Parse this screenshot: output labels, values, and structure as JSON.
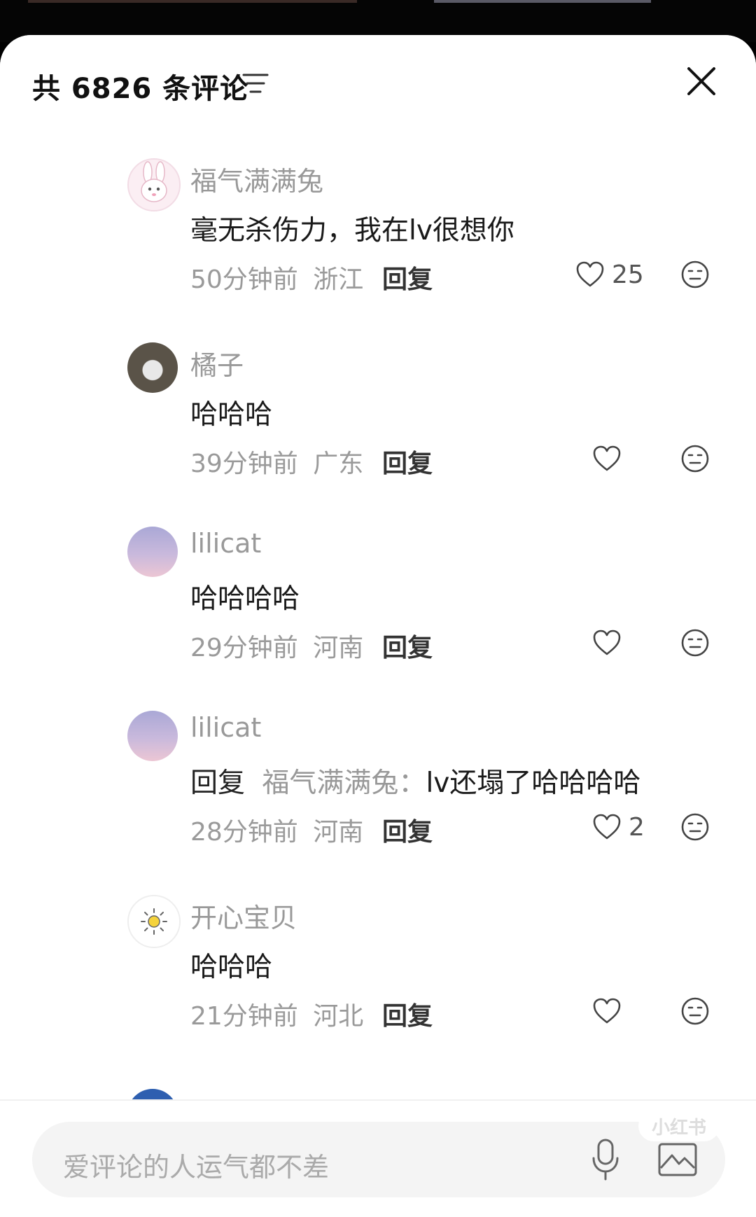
{
  "header": {
    "title": "共 6826 条评论"
  },
  "comments": [
    {
      "name": "福气满满兔",
      "text": "毫无杀伤力，我在lv很想你",
      "time": "50分钟前",
      "region": "浙江",
      "reply_label": "回复",
      "likes": "25",
      "avatar": "bunny-avatar"
    },
    {
      "name": "橘子",
      "text": "哈哈哈",
      "time": "39分钟前",
      "region": "广东",
      "reply_label": "回复",
      "likes": "",
      "avatar": "photo-avatar"
    },
    {
      "name": "lilicat",
      "text": "哈哈哈哈",
      "time": "29分钟前",
      "region": "河南",
      "reply_label": "回复",
      "likes": "",
      "avatar": "gradient-avatar"
    },
    {
      "name": "lilicat",
      "reply_prefix": "回复",
      "reply_target": "福气满满兔：",
      "text": "lv还塌了哈哈哈哈",
      "time": "28分钟前",
      "region": "河南",
      "reply_label": "回复",
      "likes": "2",
      "avatar": "gradient-avatar"
    },
    {
      "name": "开心宝贝",
      "text": "哈哈哈",
      "time": "21分钟前",
      "region": "河北",
      "reply_label": "回复",
      "likes": "",
      "avatar": "sun-avatar"
    }
  ],
  "input": {
    "placeholder": "爱评论的人运气都不差"
  },
  "watermark": "小红书",
  "colors": {
    "accent": "#111111",
    "muted": "#999999",
    "sheet": "#ffffff",
    "input_bg": "#f4f4f4"
  }
}
